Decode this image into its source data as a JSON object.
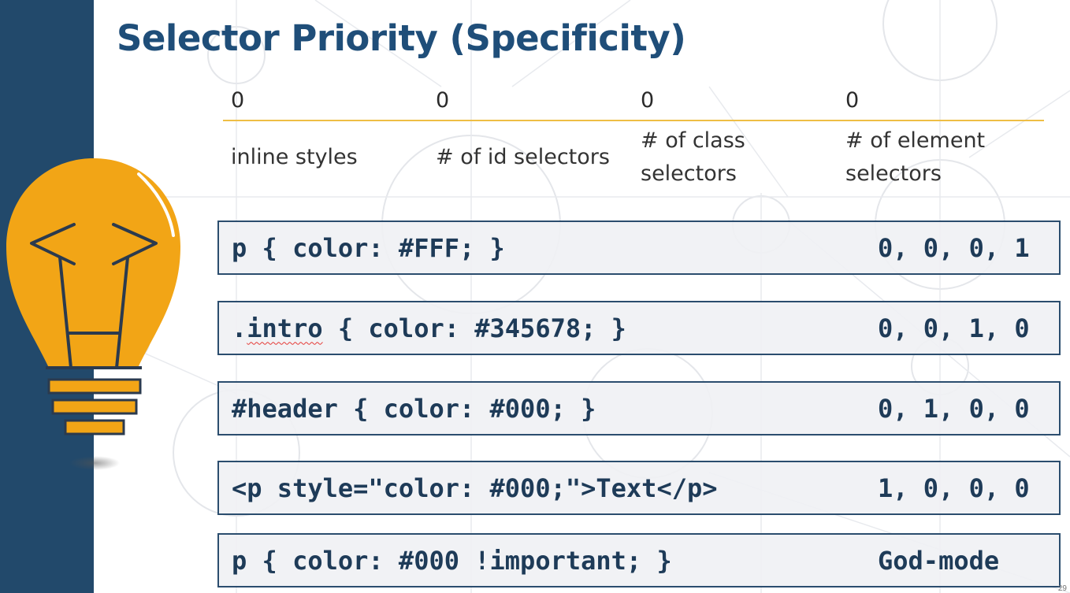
{
  "slide": {
    "title": "Selector Priority (Specificity)",
    "page_number": "29"
  },
  "specificity_table": {
    "counts": [
      "0",
      "0",
      "0",
      "0"
    ],
    "labels": [
      "inline styles",
      "# of id selectors",
      "# of class selectors",
      "# of element selectors"
    ]
  },
  "examples": [
    {
      "code": "p { color: #FFF; }",
      "specificity": "0, 0, 0, 1"
    },
    {
      "code_prefix": ".",
      "code_flagged": "intro",
      "code_suffix": " { color: #345678; }",
      "specificity": "0, 0, 1, 0"
    },
    {
      "code": "#header { color: #000; }",
      "specificity": "0, 1, 0, 0"
    },
    {
      "code": "<p style=\"color: #000;\">Text</p>",
      "specificity": "1, 0, 0, 0"
    },
    {
      "code": "p { color: #000 !important; }",
      "specificity": "God-mode"
    }
  ],
  "icons": [
    "lightbulb-code-icon"
  ],
  "colors": {
    "sidebar": "#22496b",
    "title": "#1f4e79",
    "bulb": "#f2a516",
    "divider": "#efbe45",
    "code_text": "#1e3b58"
  }
}
